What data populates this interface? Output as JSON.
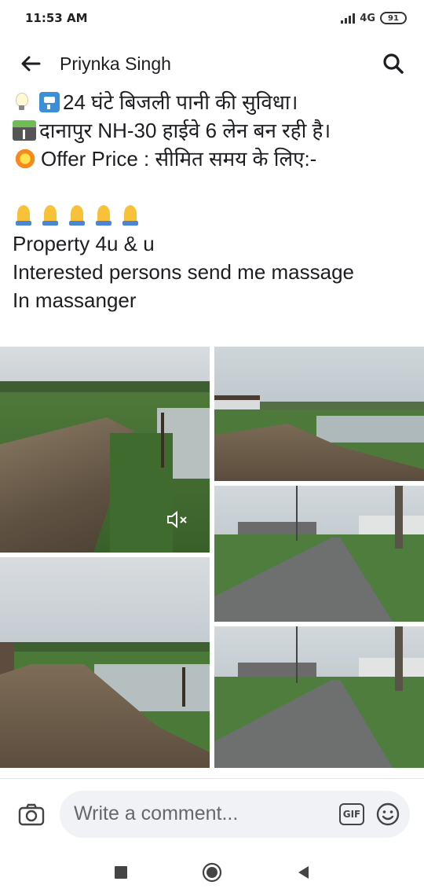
{
  "status": {
    "time": "11:53 AM",
    "network": "4G",
    "battery": "91"
  },
  "header": {
    "title": "Priynka Singh"
  },
  "post": {
    "lines": [
      "24 घंटे बिजली पानी की सुविधा।",
      "दानापुर  NH-30 हाईवे 6 लेन बन रही है।",
      "Offer Price : सीमित समय के लिए:-",
      "Property 4u & u",
      "Interested  persons send me massage",
      "In massanger"
    ]
  },
  "comment": {
    "placeholder": "Write a comment...",
    "gif_label": "GIF"
  },
  "icons": {
    "back": "arrow-left-icon",
    "search": "search-icon",
    "camera": "camera-icon",
    "gif": "gif-icon",
    "smiley": "smiley-icon",
    "mute": "speaker-muted-icon",
    "nav": [
      "square-recent-icon",
      "circle-home-icon",
      "triangle-back-icon"
    ]
  }
}
